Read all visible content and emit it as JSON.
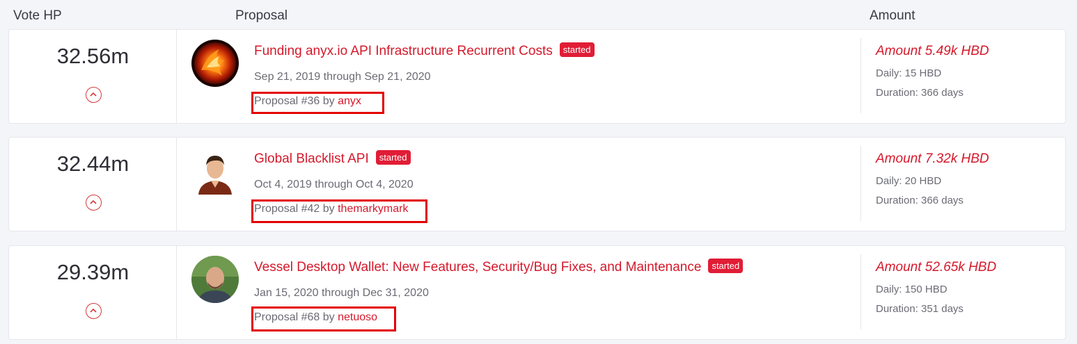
{
  "header": {
    "vote_label": "Vote HP",
    "proposal_label": "Proposal",
    "amount_label": "Amount"
  },
  "proposals": [
    {
      "vote_hp": "32.56m",
      "title": "Funding anyx.io API Infrastructure Recurrent Costs",
      "status": "started",
      "dates": "Sep 21, 2019 through Sep 21, 2020",
      "byline_prefix": "Proposal #36 by",
      "author": "anyx",
      "amount": "Amount 5.49k HBD",
      "daily": "Daily: 15 HBD",
      "duration": "Duration: 366 days",
      "avatar_icon": "phoenix-fire-avatar"
    },
    {
      "vote_hp": "32.44m",
      "title": "Global Blacklist API",
      "status": "started",
      "dates": "Oct 4, 2019 through Oct 4, 2020",
      "byline_prefix": "Proposal #42 by",
      "author": "themarkymark",
      "amount": "Amount 7.32k HBD",
      "daily": "Daily: 20 HBD",
      "duration": "Duration: 366 days",
      "avatar_icon": "man-in-brown-shirt-avatar"
    },
    {
      "vote_hp": "29.39m",
      "title": "Vessel Desktop Wallet: New Features, Security/Bug Fixes, and Maintenance",
      "status": "started",
      "dates": "Jan 15, 2020 through Dec 31, 2020",
      "byline_prefix": "Proposal #68 by",
      "author": "netuoso",
      "amount": "Amount 52.65k HBD",
      "daily": "Daily: 150 HBD",
      "duration": "Duration: 351 days",
      "avatar_icon": "bald-man-photo-avatar"
    }
  ],
  "colors": {
    "accent": "#d5192b",
    "badge": "#e11d36",
    "highlight_box": "#e30000",
    "background": "#f4f5f9"
  }
}
